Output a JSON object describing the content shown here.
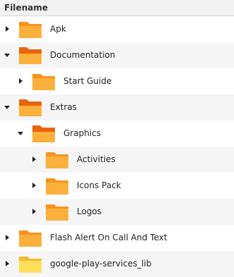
{
  "header": {
    "title": "Filename"
  },
  "colors": {
    "folder_light": "#fbb03b",
    "folder_dark": "#f7931e",
    "folder_tab": "#e8640c",
    "folder_yellow": "#ffdf5a",
    "folder_yellow_back": "#f4b92d"
  },
  "rows": [
    {
      "label": "Apk",
      "level": 0,
      "expanded": false,
      "folder_style": "orange",
      "icon": "folder-icon"
    },
    {
      "label": "Documentation",
      "level": 0,
      "expanded": true,
      "folder_style": "orange-open",
      "icon": "folder-open-icon"
    },
    {
      "label": "Start Guide",
      "level": 1,
      "expanded": false,
      "folder_style": "orange",
      "icon": "folder-icon"
    },
    {
      "label": "Extras",
      "level": 0,
      "expanded": true,
      "folder_style": "orange-open",
      "icon": "folder-open-icon"
    },
    {
      "label": "Graphics",
      "level": 1,
      "expanded": true,
      "folder_style": "orange-open",
      "icon": "folder-open-icon"
    },
    {
      "label": "Activities",
      "level": 2,
      "expanded": false,
      "folder_style": "orange",
      "icon": "folder-icon"
    },
    {
      "label": "Icons Pack",
      "level": 2,
      "expanded": false,
      "folder_style": "orange",
      "icon": "folder-icon"
    },
    {
      "label": "Logos",
      "level": 2,
      "expanded": false,
      "folder_style": "orange",
      "icon": "folder-icon"
    },
    {
      "label": "Flash Alert On Call And Text",
      "level": 0,
      "expanded": false,
      "folder_style": "orange",
      "icon": "folder-icon"
    },
    {
      "label": "google-play-services_lib",
      "level": 0,
      "expanded": false,
      "folder_style": "yellow",
      "icon": "folder-icon"
    }
  ]
}
